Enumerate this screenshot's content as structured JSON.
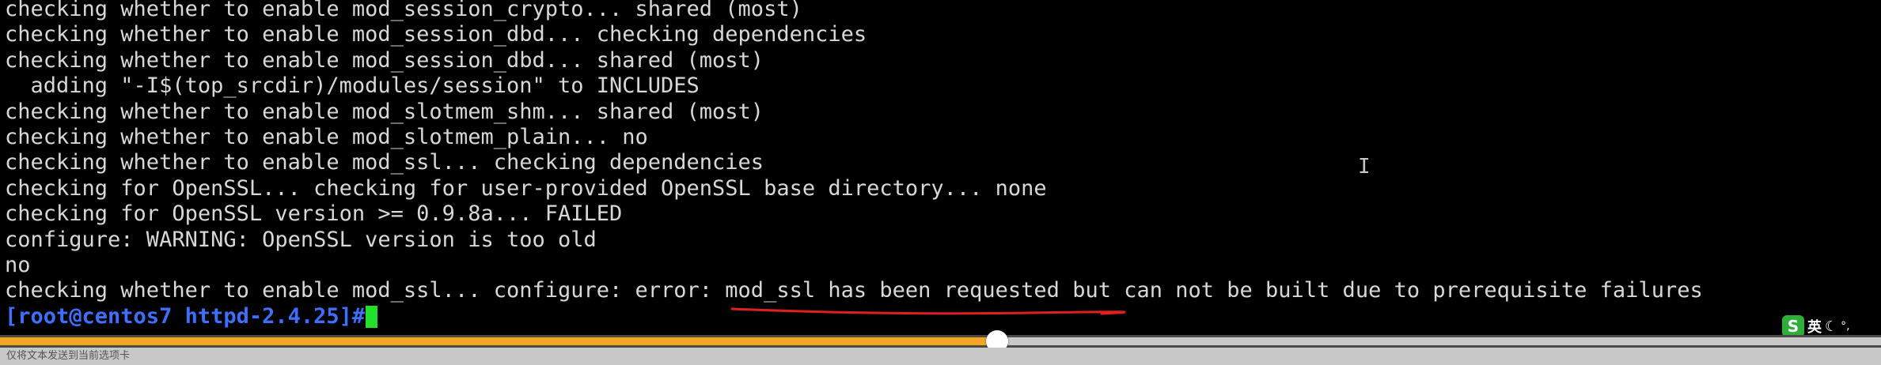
{
  "terminal": {
    "lines": [
      "checking whether to enable mod_session_crypto... shared (most)",
      "checking whether to enable mod_session_dbd... checking dependencies",
      "checking whether to enable mod_session_dbd... shared (most)",
      "  adding \"-I$(top_srcdir)/modules/session\" to INCLUDES",
      "checking whether to enable mod_slotmem_shm... shared (most)",
      "checking whether to enable mod_slotmem_plain... no",
      "checking whether to enable mod_ssl... checking dependencies",
      "checking for OpenSSL... checking for user-provided OpenSSL base directory... none",
      "checking for OpenSSL version >= 0.9.8a... FAILED",
      "configure: WARNING: OpenSSL version is too old",
      "no",
      "checking whether to enable mod_ssl... configure: error: mod_ssl has been requested but can not be built due to prerequisite failures"
    ],
    "prompt": "[root@centos7 httpd-2.4.25]#",
    "cursor_color": "#22e12a",
    "prompt_color": "#3f6fff",
    "text_color": "#d8d8d8",
    "annotation_color": "#e02020"
  },
  "player": {
    "progress_fraction": 0.53,
    "fill_color": "#f5a623"
  },
  "status_bar": {
    "text": "仅将文本发送到当前选项卡"
  },
  "ime": {
    "logo": "S",
    "lang": "英",
    "moon_icon": "☾",
    "punct": "°,"
  }
}
